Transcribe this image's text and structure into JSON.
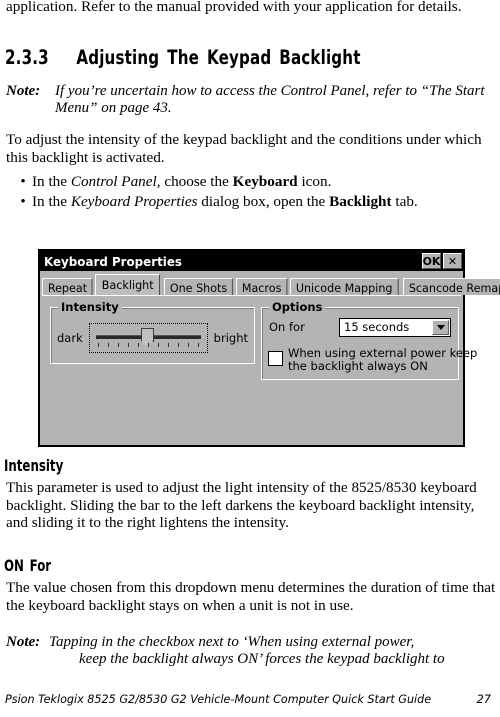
{
  "page": {
    "intro_paragraph": "application. Refer to the manual provided with your application for details.",
    "section": {
      "number": "2.3.3",
      "title": "Adjusting The Keypad Backlight"
    },
    "note_top": {
      "label": "Note:",
      "text": "If you’re uncertain how to access the Control Panel, refer to “The Start Menu” on page 43."
    },
    "lead_paragraph": "To adjust the intensity of the keypad backlight and the conditions under which this backlight is activated.",
    "bullets": [
      {
        "marker": "•",
        "pre": "In the ",
        "italic": "Control Panel",
        "mid": ", choose the ",
        "bold": "Keyboard",
        "post": " icon."
      },
      {
        "marker": "•",
        "pre": "In the ",
        "italic": "Keyboard Properties",
        "mid": " dialog box, open the ",
        "bold": "Backlight",
        "post": " tab."
      }
    ],
    "subheads": {
      "intensity": "Intensity",
      "on_for": "ON For"
    },
    "intensity_paragraph": "This parameter is used to adjust the light intensity of the 8525/8530 keyboard backlight. Sliding the bar to the left darkens the keyboard backlight intensity, and sliding it to the right lightens the intensity.",
    "on_for_paragraph": "The value chosen from this dropdown menu determines the duration of time that the keyboard backlight stays on when a unit is not in use.",
    "note_bottom": {
      "label": "Note:",
      "line1": "Tapping in the checkbox next to ‘When using external power,",
      "line2": "keep the backlight always ON’ forces the keypad backlight to"
    },
    "footer": {
      "text": "Psion Teklogix 8525 G2/8530 G2 Vehicle-Mount Computer Quick Start Guide",
      "page_number": "27"
    }
  },
  "dialog": {
    "title": "Keyboard Properties",
    "titlebar_buttons": [
      {
        "name": "ok-button",
        "label": "OK"
      },
      {
        "name": "close-button",
        "label": "✕"
      }
    ],
    "tabs": [
      {
        "label": "Repeat",
        "active": false
      },
      {
        "label": "Backlight",
        "active": true
      },
      {
        "label": "One Shots",
        "active": false
      },
      {
        "label": "Macros",
        "active": false
      },
      {
        "label": "Unicode Mapping",
        "active": false
      },
      {
        "label": "Scancode Remapping",
        "active": false
      }
    ],
    "intensity_group": {
      "legend": "Intensity",
      "left_label": "dark",
      "right_label": "bright",
      "slider_value_percent": 50,
      "tick_count": 11
    },
    "options_group": {
      "legend": "Options",
      "on_for_label": "On for",
      "on_for_value": "15 seconds",
      "checkbox_checked": false,
      "checkbox_line1": "When using external power keep",
      "checkbox_line2": "the backlight always ON"
    },
    "colors": {
      "face": "#b4b4b4",
      "titlebar": "#000000",
      "titlebar_text": "#ffffff",
      "field": "#ffffff"
    }
  }
}
